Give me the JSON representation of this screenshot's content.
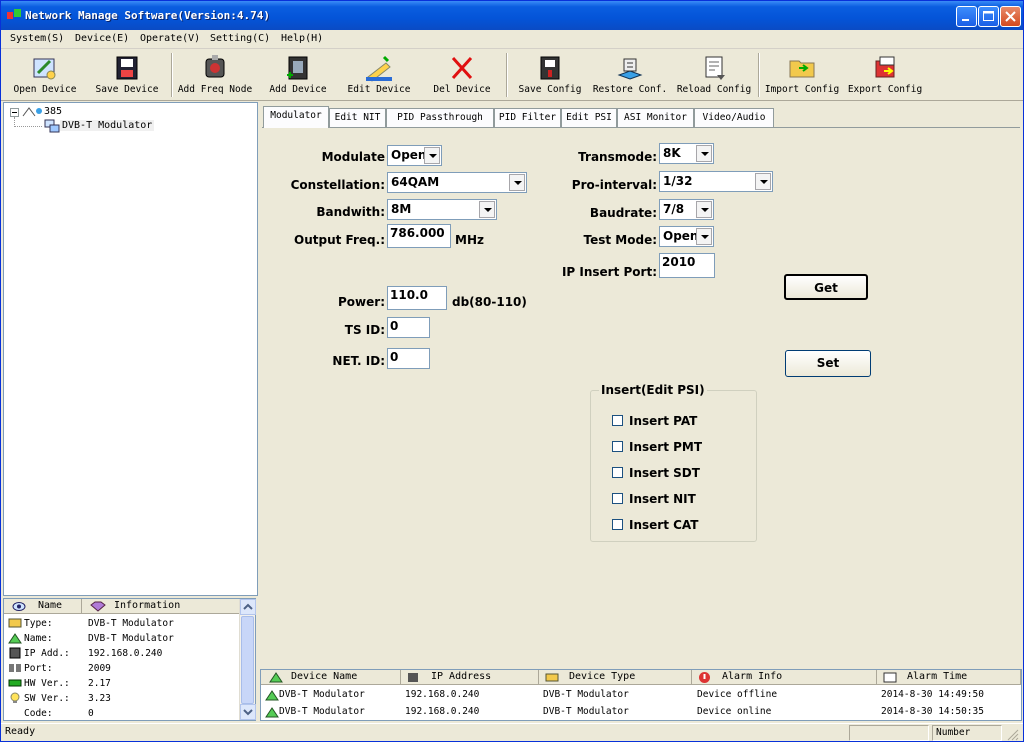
{
  "window": {
    "title": "Network Manage Software(Version:4.74)"
  },
  "menu": [
    {
      "label": "System(S)"
    },
    {
      "label": "Device(E)"
    },
    {
      "label": "Operate(V)"
    },
    {
      "label": "Setting(C)"
    },
    {
      "label": "Help(H)"
    }
  ],
  "toolbar": [
    {
      "label": "Open Device",
      "icon": "open-device-icon"
    },
    {
      "label": "Save Device",
      "icon": "save-device-icon"
    },
    {
      "label": "Add Freq Node",
      "icon": "add-freq-node-icon"
    },
    {
      "label": "Add Device",
      "icon": "add-device-icon"
    },
    {
      "label": "Edit Device",
      "icon": "edit-device-icon"
    },
    {
      "label": "Del Device",
      "icon": "delete-icon"
    },
    {
      "label": "Save Config",
      "icon": "save-config-icon"
    },
    {
      "label": "Restore Conf.",
      "icon": "restore-config-icon"
    },
    {
      "label": "Reload Config",
      "icon": "reload-config-icon"
    },
    {
      "label": "Import Config",
      "icon": "import-config-icon"
    },
    {
      "label": "Export Config",
      "icon": "export-config-icon"
    }
  ],
  "tree": {
    "root": "385",
    "child": "DVB-T Modulator"
  },
  "info": {
    "header_name": "Name",
    "header_info": "Information",
    "rows": [
      {
        "name": "Type:",
        "value": "DVB-T Modulator"
      },
      {
        "name": "Name:",
        "value": "DVB-T Modulator"
      },
      {
        "name": "IP Add.:",
        "value": "192.168.0.240"
      },
      {
        "name": "Port:",
        "value": "2009"
      },
      {
        "name": "HW Ver.:",
        "value": "2.17"
      },
      {
        "name": "SW Ver.:",
        "value": "3.23"
      },
      {
        "name": "Code:",
        "value": "0"
      }
    ]
  },
  "tabs": [
    {
      "label": "Modulator"
    },
    {
      "label": "Edit NIT"
    },
    {
      "label": "PID Passthrough"
    },
    {
      "label": "PID Filter"
    },
    {
      "label": "Edit PSI"
    },
    {
      "label": "ASI Monitor"
    },
    {
      "label": "Video/Audio"
    }
  ],
  "form": {
    "modulate_label": "Modulate",
    "modulate_value": "Open",
    "constellation_label": "Constellation:",
    "constellation_value": "64QAM",
    "bandwidth_label": "Bandwith:",
    "bandwidth_value": "8M",
    "output_freq_label": "Output Freq.:",
    "output_freq_value": "786.000",
    "output_freq_unit": "MHz",
    "transmode_label": "Transmode:",
    "transmode_value": "8K",
    "pro_interval_label": "Pro-interval:",
    "pro_interval_value": "1/32",
    "baudrate_label": "Baudrate:",
    "baudrate_value": "7/8",
    "test_mode_label": "Test Mode:",
    "test_mode_value": "Open",
    "ip_insert_port_label": "IP Insert Port:",
    "ip_insert_port_value": "2010",
    "power_label": "Power:",
    "power_value": "110.0",
    "power_unit": "db(80-110)",
    "ts_id_label": "TS ID:",
    "ts_id_value": "0",
    "net_id_label": "NET. ID:",
    "net_id_value": "0",
    "get_label": "Get",
    "set_label": "Set",
    "insert_group_label": "Insert(Edit PSI)",
    "insert_pat": "Insert PAT",
    "insert_pmt": "Insert PMT",
    "insert_sdt": "Insert SDT",
    "insert_nit": "Insert NIT",
    "insert_cat": "Insert CAT"
  },
  "alarm": {
    "headers": [
      "Device Name",
      "IP Address",
      "Device Type",
      "Alarm Info",
      "Alarm Time"
    ],
    "rows": [
      {
        "name": "DVB-T Modulator",
        "ip": "192.168.0.240",
        "type": "DVB-T Modulator",
        "info": "Device offline",
        "time": "2014-8-30 14:49:50"
      },
      {
        "name": "DVB-T Modulator",
        "ip": "192.168.0.240",
        "type": "DVB-T Modulator",
        "info": "Device online",
        "time": "2014-8-30 14:50:35"
      }
    ]
  },
  "status": {
    "text": "Ready",
    "number": "Number"
  }
}
